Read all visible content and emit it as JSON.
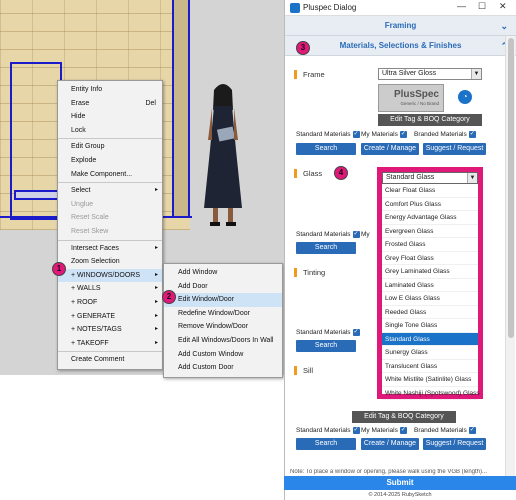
{
  "viewport": {
    "context_menu": [
      {
        "label": "Entity Info"
      },
      {
        "label": "Erase",
        "shortcut": "Del"
      },
      {
        "label": "Hide"
      },
      {
        "label": "Lock"
      },
      {
        "label": "Edit Group"
      },
      {
        "label": "Explode"
      },
      {
        "label": "Make Component..."
      },
      {
        "label": "Select"
      },
      {
        "label": "Unglue"
      },
      {
        "label": "Reset Scale"
      },
      {
        "label": "Reset Skew"
      },
      {
        "label": "Intersect Faces"
      },
      {
        "label": "Zoom Selection"
      },
      {
        "label": "+ WINDOWS/DOORS"
      },
      {
        "label": "+ WALLS"
      },
      {
        "label": "+ ROOF"
      },
      {
        "label": "+ GENERATE"
      },
      {
        "label": "+ NOTES/TAGS"
      },
      {
        "label": "+ TAKEOFF"
      },
      {
        "label": "Create Comment"
      }
    ],
    "submenu": [
      {
        "label": "Add Window"
      },
      {
        "label": "Add Door"
      },
      {
        "label": "Edit Window/Door"
      },
      {
        "label": "Redefine Window/Door"
      },
      {
        "label": "Remove Window/Door"
      },
      {
        "label": "Edit All Windows/Doors In Wall"
      },
      {
        "label": "Add Custom Window"
      },
      {
        "label": "Add Custom Door"
      }
    ],
    "badges": [
      "1",
      "2"
    ]
  },
  "dialog": {
    "title": "Pluspec Dialog",
    "controls": {
      "minimize": "—",
      "maximize": "☐",
      "close": "✕"
    },
    "sections": {
      "framing": "Framing",
      "materials": "Materials, Selections & Finishes"
    },
    "badges": [
      "3",
      "4"
    ],
    "frame": {
      "label": "Frame",
      "value": "Ultra Silver Gloss",
      "logo_text": "PlusSpec",
      "logo_sub": "Generic / No Brand",
      "edit_tag": "Edit Tag & BOQ Category"
    },
    "glass": {
      "label": "Glass"
    },
    "tinting": {
      "label": "Tinting"
    },
    "sill": {
      "label": "Sill",
      "edit_tag": "Edit Tag & BOQ Category"
    },
    "checkbox_row": {
      "standard": "Standard Materials",
      "standard_short": "Standard Materials",
      "my": "My Materials",
      "my_short": "My",
      "branded": "Branded Materials"
    },
    "buttons": {
      "search": "Search",
      "create": "Create / Manage",
      "suggest": "Suggest / Request",
      "submit": "Submit"
    },
    "glass_dropdown": {
      "selected": "Standard Glass",
      "options": [
        "Clear Float Glass",
        "Comfort Plus Glass",
        "Energy Advantage Glass",
        "Evergreen Glass",
        "Frosted Glass",
        "Grey Float Glass",
        "Grey Laminated Glass",
        "Laminated Glass",
        "Low E Glass Glass",
        "Reeded Glass",
        "Single Tone Glass",
        "Standard Glass",
        "Sunergy Glass",
        "Translucent Glass",
        "White Mistlite (Satinlite) Glass",
        "White Nashiji (Spotswood) Glass"
      ]
    },
    "note": "Note: To place a window or opening, please walk using the VGB (length)...",
    "copyright": "© 2014-2025 RubySketch"
  },
  "colors": {
    "accent": "#2a6bb8",
    "highlight": "#e0187a",
    "orange": "#f29a1e"
  }
}
